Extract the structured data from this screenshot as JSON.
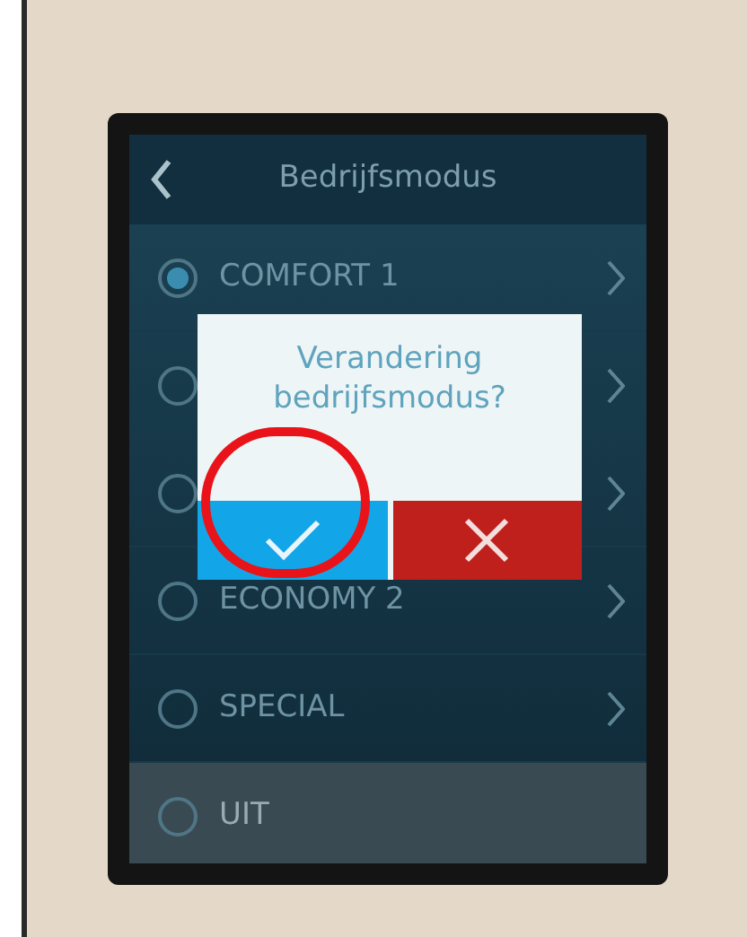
{
  "header": {
    "title": "Bedrijfsmodus"
  },
  "modes": [
    {
      "label": "COMFORT 1",
      "selected": true,
      "highlighted": false
    },
    {
      "selected": false,
      "highlighted": false
    },
    {
      "selected": false,
      "highlighted": false
    },
    {
      "label": "ECONOMY 2",
      "selected": false,
      "highlighted": false
    },
    {
      "label": "SPECIAL",
      "selected": false,
      "highlighted": false
    },
    {
      "label": "UIT",
      "selected": false,
      "highlighted": true
    }
  ],
  "dialog": {
    "message": "Verandering bedrijfsmodus?",
    "buttons": [
      {
        "kind": "confirm"
      },
      {
        "kind": "cancel"
      }
    ]
  }
}
